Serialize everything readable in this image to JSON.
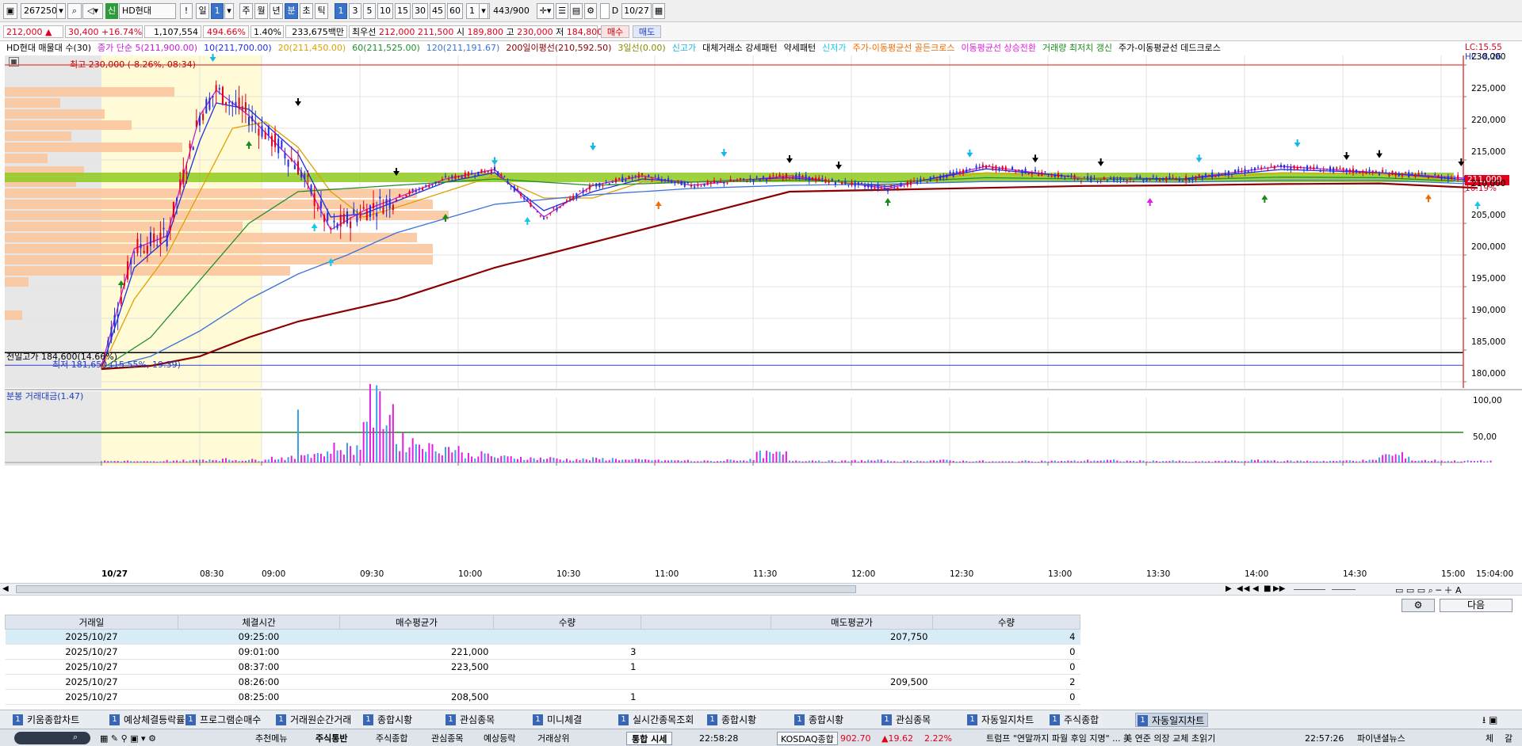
{
  "toolbar": {
    "code": "267250",
    "sin_badge": "신",
    "stock_name": "HD현대",
    "excl": "!",
    "il": "일",
    "one": "1",
    "ju": "주",
    "wol": "월",
    "nyeon": "년",
    "bun": "분",
    "cho": "초",
    "tik": "틱",
    "intervals": [
      "1",
      "3",
      "5",
      "10",
      "15",
      "30",
      "45",
      "60"
    ],
    "count_select": "1",
    "bar_count": "443/900",
    "date_check": "D",
    "date": "10/27"
  },
  "quote": {
    "price": "212,000",
    "change": "30,400",
    "change_pct": "+16.74%",
    "volume": "1,107,554",
    "vol_ratio": "494.66%",
    "turnover": "1.40%",
    "amount": "233,675백만",
    "best_label": "최우선",
    "best_sell": "212,000",
    "best_buy": "211,500",
    "open_label": "시",
    "open": "189,800",
    "high_label": "고",
    "high": "230,000",
    "low_label": "저",
    "low": "184,800",
    "buy_btn": "매수",
    "sell_btn": "매도",
    "accent_up": "#e0001b",
    "accent_blue": "#1f3fbf"
  },
  "legend": {
    "items": [
      {
        "text": "HD현대 매물대 수(30)",
        "color": "#000000"
      },
      {
        "text": "종가 단순 5(211,900.00)",
        "color": "#c81cd8"
      },
      {
        "text": "10(211,700.00)",
        "color": "#1f2fe0"
      },
      {
        "text": "20(211,450.00)",
        "color": "#e0a000"
      },
      {
        "text": "60(211,525.00)",
        "color": "#1f8f2f"
      },
      {
        "text": "120(211,191.67)",
        "color": "#3b73d8"
      },
      {
        "text": "200일이평선(210,592.50)",
        "color": "#8b0000"
      },
      {
        "text": "3일선(0.00)",
        "color": "#8a8a00"
      },
      {
        "text": "신고가",
        "color": "#16b6e8"
      },
      {
        "text": "대체거래소 강세패턴",
        "color": "#000000"
      },
      {
        "text": "약세패턴",
        "color": "#000000"
      },
      {
        "text": "신저가",
        "color": "#16c8e8"
      },
      {
        "text": "주가-이동평균선 골든크로스",
        "color": "#f06a00"
      },
      {
        "text": "이동평균선 상승전환",
        "color": "#e020e0"
      },
      {
        "text": "거래량 최저치 갱신",
        "color": "#1a8a1a"
      },
      {
        "text": "주가-이동평균선 데드크로스",
        "color": "#000000"
      }
    ],
    "lc": "LC:15.55",
    "hc": "HC:-8.26"
  },
  "annotations": {
    "high_note": "최고 230,000 (-8.26%, 08:34)",
    "prev_close_note": "전일고가 184,600(14.66%)",
    "low_note": "최저 181,650 (15.55%, 19:39)",
    "last_price_tag": "211,000",
    "last_pct_tag": "16.19%"
  },
  "price_axis": [
    "230,000",
    "225,000",
    "220,000",
    "215,000",
    "210,000",
    "205,000",
    "200,000",
    "195,000",
    "190,000",
    "185,000",
    "180,000"
  ],
  "volume_panel": {
    "title": "분봉 거래대금(1.47)",
    "axis": [
      "100,00",
      "50,00"
    ]
  },
  "time_axis": [
    "10/27",
    "08:30",
    "09:00",
    "09:30",
    "10:00",
    "10:30",
    "11:00",
    "11:30",
    "12:00",
    "12:30",
    "13:00",
    "13:30",
    "14:00",
    "14:30",
    "15:00",
    "15:04:00"
  ],
  "chart_data": {
    "type": "line",
    "ylim": [
      179000,
      231500
    ],
    "x_start": "08:00",
    "x_end": "15:04",
    "series": [
      {
        "name": "종가 단순 5",
        "color": "#c81cd8",
        "x": [
          "08:00",
          "08:10",
          "08:20",
          "08:30",
          "08:35",
          "08:45",
          "09:00",
          "09:10",
          "09:20",
          "09:30",
          "09:45",
          "10:00",
          "10:15",
          "10:30",
          "10:45",
          "11:00",
          "11:30",
          "12:00",
          "12:30",
          "13:00",
          "13:30",
          "14:00",
          "14:30",
          "15:00"
        ],
        "values": [
          182500,
          201000,
          203000,
          222000,
          226000,
          222000,
          214000,
          204000,
          207000,
          209000,
          212000,
          213500,
          206000,
          211000,
          212500,
          211000,
          212500,
          210500,
          214000,
          212000,
          212000,
          214000,
          213000,
          212000
        ]
      },
      {
        "name": "10",
        "color": "#1f2fe0",
        "x": [
          "08:00",
          "08:10",
          "08:20",
          "08:30",
          "08:35",
          "08:45",
          "09:00",
          "09:10",
          "09:20",
          "09:30",
          "09:45",
          "10:00",
          "10:15",
          "10:30",
          "10:45",
          "11:00",
          "11:30",
          "12:00",
          "12:30",
          "13:00",
          "13:30",
          "14:00",
          "14:30",
          "15:00"
        ],
        "values": [
          182000,
          198000,
          202500,
          218000,
          224000,
          223000,
          216000,
          206000,
          206500,
          208500,
          211500,
          213000,
          207000,
          210000,
          212000,
          211500,
          212200,
          210800,
          213600,
          212200,
          212000,
          213500,
          213000,
          211700
        ]
      },
      {
        "name": "20",
        "color": "#e0a000",
        "x": [
          "08:00",
          "08:10",
          "08:20",
          "08:30",
          "08:40",
          "08:50",
          "09:00",
          "09:10",
          "09:20",
          "09:30",
          "09:45",
          "10:00",
          "10:15",
          "10:30",
          "10:45",
          "11:00",
          "11:30",
          "12:00",
          "12:30",
          "13:00",
          "13:30",
          "14:00",
          "14:30",
          "15:00"
        ],
        "values": [
          182000,
          193000,
          200000,
          210000,
          220000,
          221000,
          217000,
          210000,
          206000,
          207500,
          210000,
          212500,
          209000,
          209000,
          211500,
          211500,
          212000,
          211000,
          213000,
          212200,
          211800,
          213000,
          212800,
          211450
        ]
      },
      {
        "name": "60",
        "color": "#1f8f2f",
        "x": [
          "08:00",
          "08:15",
          "08:30",
          "08:45",
          "09:00",
          "09:15",
          "09:30",
          "10:00",
          "10:30",
          "11:00",
          "11:30",
          "12:00",
          "12:30",
          "13:00",
          "13:30",
          "14:00",
          "14:30",
          "15:00"
        ],
        "values": [
          182000,
          187000,
          196000,
          205000,
          210000,
          210500,
          211000,
          212000,
          211000,
          211500,
          211800,
          211500,
          212200,
          212000,
          211900,
          212300,
          212200,
          211525
        ]
      },
      {
        "name": "120",
        "color": "#3b73d8",
        "x": [
          "08:00",
          "08:15",
          "08:30",
          "08:45",
          "09:00",
          "09:15",
          "09:30",
          "10:00",
          "10:30",
          "11:00",
          "11:30",
          "12:00",
          "12:30",
          "13:00",
          "13:30",
          "14:00",
          "14:30",
          "15:00"
        ],
        "values": [
          182000,
          184000,
          188000,
          193000,
          197000,
          200000,
          203500,
          208000,
          209500,
          210500,
          211000,
          211200,
          211600,
          211600,
          211500,
          211800,
          211800,
          211192
        ]
      },
      {
        "name": "200일이평선",
        "color": "#8b0000",
        "x": [
          "08:00",
          "08:15",
          "08:30",
          "08:45",
          "09:00",
          "09:30",
          "10:00",
          "10:30",
          "11:00",
          "11:30",
          "12:00",
          "12:30",
          "13:00",
          "13:30",
          "14:00",
          "14:30",
          "15:00"
        ],
        "values": [
          182000,
          182500,
          184000,
          187000,
          189500,
          193000,
          198000,
          202000,
          206000,
          210000,
          210300,
          210600,
          210900,
          211000,
          211200,
          211300,
          210593
        ]
      }
    ],
    "volume": {
      "peak_time": "09:00",
      "peak": 105,
      "levels": [
        3,
        2,
        4,
        6,
        5,
        9,
        18,
        28,
        105,
        40,
        28,
        15,
        10,
        8,
        6,
        7,
        5,
        4,
        3,
        5,
        16,
        4,
        3,
        4,
        3,
        4,
        3,
        2,
        3,
        3,
        4,
        3,
        3,
        2,
        3,
        4,
        3,
        3,
        4,
        14,
        4,
        3,
        3,
        2
      ]
    }
  },
  "scroll": {
    "nav_buttons": [
      "◀◀",
      "◀",
      "■",
      "▶▶"
    ]
  },
  "trades": {
    "headers": [
      "거래일",
      "체결시간",
      "매수평균가",
      "수량",
      "매도평균가",
      "수량"
    ],
    "rows": [
      {
        "date": "2025/10/27",
        "time": "09:25:00",
        "buy": "",
        "buy_qty": "",
        "sell": "207,750",
        "sell_qty": "4"
      },
      {
        "date": "2025/10/27",
        "time": "09:01:00",
        "buy": "221,000",
        "buy_qty": "3",
        "sell": "",
        "sell_qty": "0"
      },
      {
        "date": "2025/10/27",
        "time": "08:37:00",
        "buy": "223,500",
        "buy_qty": "1",
        "sell": "",
        "sell_qty": "0"
      },
      {
        "date": "2025/10/27",
        "time": "08:26:00",
        "buy": "",
        "buy_qty": "",
        "sell": "209,500",
        "sell_qty": "2"
      },
      {
        "date": "2025/10/27",
        "time": "08:25:00",
        "buy": "208,500",
        "buy_qty": "1",
        "sell": "",
        "sell_qty": "0"
      }
    ],
    "next_btn": "다음"
  },
  "bottom_tabs": [
    {
      "num": "1",
      "label": "키움종합차트"
    },
    {
      "num": "1",
      "label": "예상체결등락률"
    },
    {
      "num": "1",
      "label": "프로그램순매수"
    },
    {
      "num": "1",
      "label": "거래원순간거래"
    },
    {
      "num": "1",
      "label": "종합시황"
    },
    {
      "num": "1",
      "label": "관심종목"
    },
    {
      "num": "1",
      "label": "미니체결"
    },
    {
      "num": "1",
      "label": "실시간종목조회"
    },
    {
      "num": "1",
      "label": "종합시황"
    },
    {
      "num": "1",
      "label": "종합시황"
    },
    {
      "num": "1",
      "label": "관심종목"
    },
    {
      "num": "1",
      "label": "자동일지차트"
    },
    {
      "num": "1",
      "label": "주식종합"
    },
    {
      "num": "1",
      "label": "자동일지차트"
    }
  ],
  "taskbar": {
    "menu1": "추천메뉴",
    "menu2": "주식통반",
    "menu3": "주식종합",
    "menu4": "관심종목",
    "menu5": "예상등락",
    "menu6": "거래상위",
    "integrated": "통합 시세",
    "clock1": "22:58:28",
    "index_name": "KOSDAQ종합",
    "index_val": "902.70",
    "index_chg": "▲19.62",
    "index_pct": "2.22%",
    "news": "트럼프 \"연말까지 파월 후임 지명\" ... 美 연준 의장 교체 초읽기",
    "clock2": "22:57:26",
    "news_src": "파이낸셜뉴스",
    "end1": "체",
    "end2": "갈"
  }
}
